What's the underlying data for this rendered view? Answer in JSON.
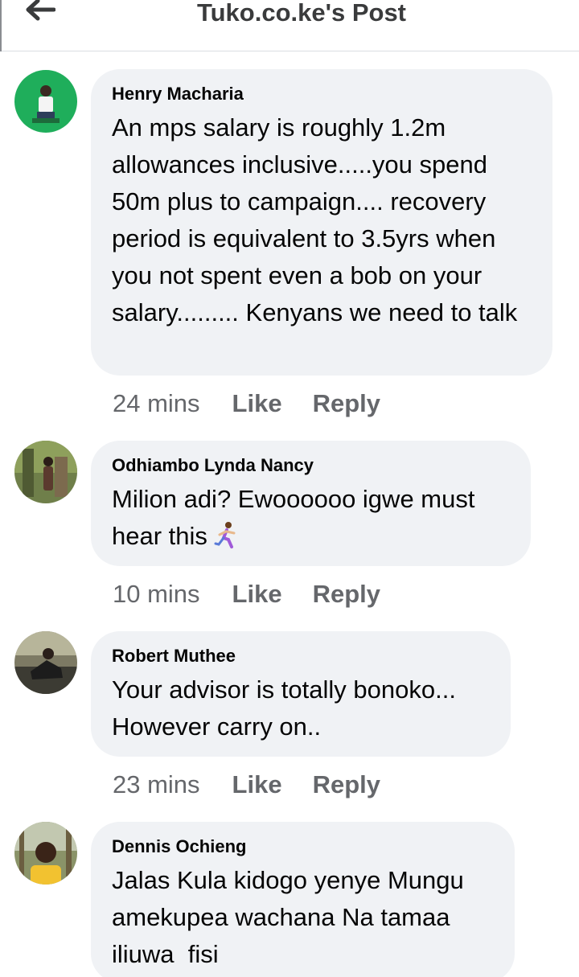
{
  "header": {
    "back_icon": "arrow-left-icon",
    "title": "Tuko.co.ke's Post"
  },
  "comments": [
    {
      "author": "Henry Macharia",
      "text": "An mps salary is roughly 1.2m allowances inclusive.....you spend 50m plus to campaign.... recovery period is equivalent to 3.5yrs when you not spent even a bob on your salary......... Kenyans we need to talk",
      "time": "24 mins",
      "like_label": "Like",
      "reply_label": "Reply"
    },
    {
      "author": "Odhiambo Lynda Nancy",
      "text": "Milion adi? Ewoooooo igwe must hear this",
      "emoji": "woman-running-emoji",
      "time": "10 mins",
      "like_label": "Like",
      "reply_label": "Reply"
    },
    {
      "author": "Robert Muthee",
      "text": "Your advisor is totally bonoko... However carry on..",
      "time": "23 mins",
      "like_label": "Like",
      "reply_label": "Reply"
    },
    {
      "author": "Dennis Ochieng",
      "text": "Jalas Kula kidogo yenye Mungu amekupea wachana Na tamaa iliuwa  fisi"
    }
  ],
  "colors": {
    "bubble": "#f0f2f5",
    "meta_text": "#65676b",
    "divider": "#dadde1"
  }
}
